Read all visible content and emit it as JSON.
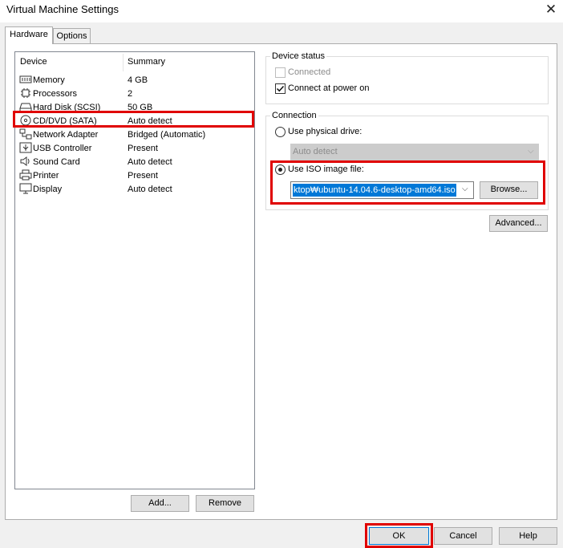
{
  "window": {
    "title": "Virtual Machine Settings",
    "close_glyph": "✕"
  },
  "tabs": [
    {
      "label": "Hardware",
      "active": true
    },
    {
      "label": "Options",
      "active": false
    }
  ],
  "device_list": {
    "columns": [
      "Device",
      "Summary"
    ],
    "rows": [
      {
        "icon": "memory-icon",
        "device": "Memory",
        "summary": "4 GB"
      },
      {
        "icon": "processor-icon",
        "device": "Processors",
        "summary": "2"
      },
      {
        "icon": "hard-disk-icon",
        "device": "Hard Disk (SCSI)",
        "summary": "50 GB"
      },
      {
        "icon": "cd-dvd-icon",
        "device": "CD/DVD (SATA)",
        "summary": "Auto detect",
        "selected": true
      },
      {
        "icon": "network-adapter-icon",
        "device": "Network Adapter",
        "summary": "Bridged (Automatic)"
      },
      {
        "icon": "usb-icon",
        "device": "USB Controller",
        "summary": "Present"
      },
      {
        "icon": "sound-card-icon",
        "device": "Sound Card",
        "summary": "Auto detect"
      },
      {
        "icon": "printer-icon",
        "device": "Printer",
        "summary": "Present"
      },
      {
        "icon": "display-icon",
        "device": "Display",
        "summary": "Auto detect"
      }
    ],
    "add_label": "Add...",
    "remove_label": "Remove"
  },
  "device_status": {
    "title": "Device status",
    "connected_label": "Connected",
    "connected_checked": false,
    "connected_enabled": false,
    "connect_power_label": "Connect at power on",
    "connect_power_checked": true
  },
  "connection": {
    "title": "Connection",
    "physical_label": "Use physical drive:",
    "physical_selected": false,
    "physical_value": "Auto detect",
    "iso_label": "Use ISO image file:",
    "iso_selected": true,
    "iso_value": "ktop₩ubuntu-14.04.6-desktop-amd64.iso",
    "browse_label": "Browse..."
  },
  "advanced_label": "Advanced...",
  "footer": {
    "ok_label": "OK",
    "cancel_label": "Cancel",
    "help_label": "Help"
  },
  "colors": {
    "highlight_box": "#e00000",
    "selection": "#0078d7"
  }
}
